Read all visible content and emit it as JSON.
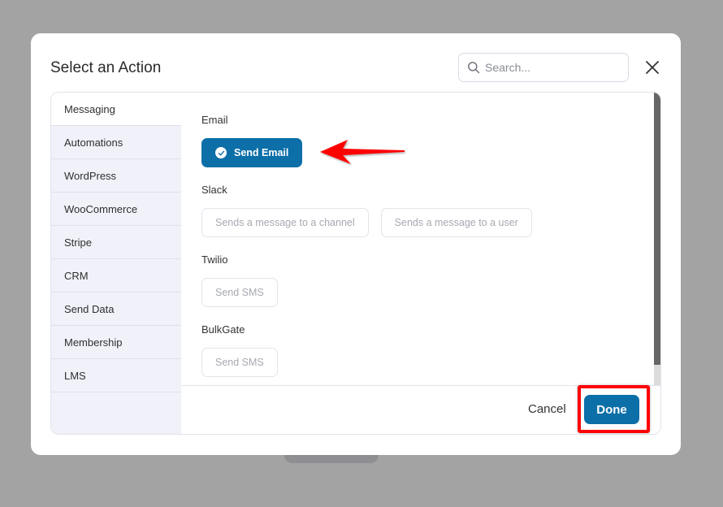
{
  "background": {
    "obscured_button_label": ""
  },
  "modal": {
    "title": "Select an Action",
    "search": {
      "placeholder": "Search...",
      "value": ""
    },
    "close_icon": "close-icon"
  },
  "sidebar": {
    "active_index": 0,
    "items": [
      {
        "label": "Messaging"
      },
      {
        "label": "Automations"
      },
      {
        "label": "WordPress"
      },
      {
        "label": "WooCommerce"
      },
      {
        "label": "Stripe"
      },
      {
        "label": "CRM"
      },
      {
        "label": "Send Data"
      },
      {
        "label": "Membership"
      },
      {
        "label": "LMS"
      }
    ]
  },
  "groups": [
    {
      "label": "Email",
      "actions": [
        {
          "label": "Send Email",
          "selected": true
        }
      ]
    },
    {
      "label": "Slack",
      "actions": [
        {
          "label": "Sends a message to a channel",
          "selected": false
        },
        {
          "label": "Sends a message to a user",
          "selected": false
        }
      ]
    },
    {
      "label": "Twilio",
      "actions": [
        {
          "label": "Send SMS",
          "selected": false
        }
      ]
    },
    {
      "label": "BulkGate",
      "actions": [
        {
          "label": "Send SMS",
          "selected": false
        }
      ]
    }
  ],
  "footer": {
    "cancel_label": "Cancel",
    "done_label": "Done"
  },
  "colors": {
    "primary": "#0c6fa8",
    "annotation": "#ff0000",
    "sidebar_bg": "#f0f1f9"
  },
  "annotations": {
    "arrow_target": "Send Email",
    "highlight_target": "Done"
  }
}
